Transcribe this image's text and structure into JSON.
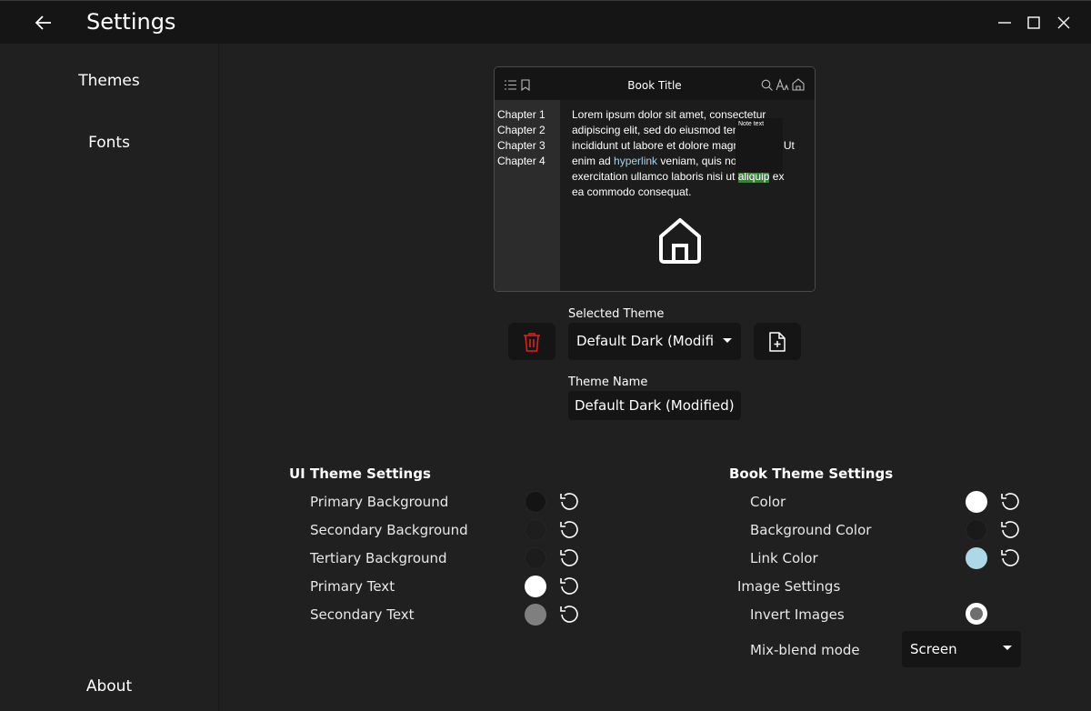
{
  "window": {
    "title": "Settings"
  },
  "sidebar": {
    "items": [
      {
        "label": "Themes"
      },
      {
        "label": "Fonts"
      }
    ],
    "about_label": "About"
  },
  "preview": {
    "book_title": "Book Title",
    "chapters": [
      "Chapter 1",
      "Chapter 2",
      "Chapter 3",
      "Chapter 4"
    ],
    "text_before_link": "Lorem ipsum dolor sit amet, consectetur adipiscing elit, sed do eiusmod tempor incididunt ut labore et dolore magna aliqua. Ut enim ad ",
    "link_text": "hyperlink",
    "text_after_link": " veniam, quis nostrud exercitation ullamco laboris nisi ut ",
    "highlight_text": "aliquip",
    "text_end": " ex ea commodo consequat.",
    "note_text": "Note text"
  },
  "theme": {
    "selected_label": "Selected Theme",
    "selected_value": "Default Dark (Modified)",
    "name_label": "Theme Name",
    "name_value": "Default Dark (Modified)"
  },
  "ui_settings": {
    "heading": "UI Theme Settings",
    "rows": [
      {
        "label": "Primary Background",
        "color": "#141414"
      },
      {
        "label": "Secondary Background",
        "color": "#1e1e1e"
      },
      {
        "label": "Tertiary Background",
        "color": "#1c1c1c"
      },
      {
        "label": "Primary Text",
        "color": "#ffffff"
      },
      {
        "label": "Secondary Text",
        "color": "#7f7f7f"
      }
    ]
  },
  "book_settings": {
    "heading": "Book Theme Settings",
    "rows": [
      {
        "label": "Color",
        "color": "#ffffff"
      },
      {
        "label": "Background Color",
        "color": "#1a1a1a"
      },
      {
        "label": "Link Color",
        "color": "#add8e6"
      }
    ],
    "image_heading": "Image Settings",
    "invert_label": "Invert Images",
    "blend_label": "Mix-blend mode",
    "blend_value": "Screen"
  },
  "colors": {
    "delete_icon": "#e0201b",
    "highlight": "#3d7d3d",
    "link": "#a9d3e6"
  }
}
